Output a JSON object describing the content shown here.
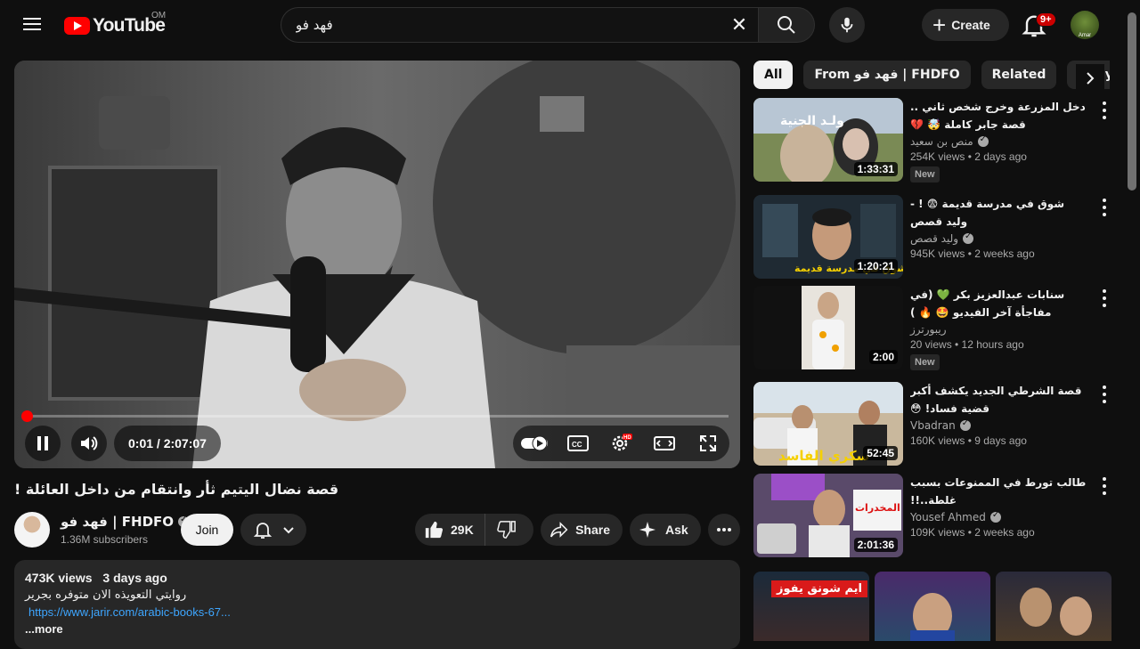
{
  "topbar": {
    "logo_text": "YouTube",
    "country_code": "OM",
    "search_value": "فهد فو",
    "create_label": "Create",
    "notifications_badge": "9+"
  },
  "player": {
    "time_display": "0:01 / 2:07:07",
    "progress_fraction": 0.001
  },
  "video": {
    "title": "قصة نضال اليتيم ثأر وانتقام من داخل العائلة !",
    "channel_name": "فهد فو | FHDFO",
    "subscribers": "1.36M subscribers",
    "join_label": "Join",
    "likes": "29K",
    "share_label": "Share",
    "ask_label": "Ask"
  },
  "description": {
    "views": "473K views",
    "age": "3 days ago",
    "line1": "روايتي التعويذه الان متوفره بجرير",
    "link": "https://www.jarir.com/arabic-books-67...",
    "more": "...more"
  },
  "chips": [
    {
      "label": "All"
    },
    {
      "label": "From فهد فو | FHDFO"
    },
    {
      "label": "Related"
    },
    {
      "label": "For you"
    }
  ],
  "recommendations": [
    {
      "title": "دخل المزرعة وخرج شخص ثاني .. قصة جابر كاملة 🤯 💔",
      "channel": "منص بن سعيد",
      "verified": true,
      "stats": "254K views • 2 days ago",
      "duration": "1:33:31",
      "badge": "New",
      "thumb_text": "ولـد الجنية"
    },
    {
      "title": "شوق في مدرسة قديمة 😨 ! - وليد قصص",
      "channel": "وليد قصص",
      "verified": true,
      "stats": "945K views • 2 weeks ago",
      "duration": "1:20:21",
      "badge": "",
      "thumb_text": "شوق في مدرسة قديمة !"
    },
    {
      "title": "سنابات عبدالعزيز بكر 💚 (في مفاجأة آخر الفيديو 🤩 🔥 )",
      "channel": "ريبورترز",
      "verified": false,
      "stats": "20 views • 12 hours ago",
      "duration": "2:00",
      "badge": "New",
      "thumb_text": ""
    },
    {
      "title": "قصة الشرطي الجديد يكشف أكبر قضية فساد! 😳",
      "channel": "Vbadran",
      "verified": true,
      "stats": "160K views • 9 days ago",
      "duration": "52:45",
      "badge": "",
      "thumb_text": "سكري الفاسد"
    },
    {
      "title": "طالب تورط في الممنوعات بسبب غلطة..!!",
      "channel": "Yousef Ahmed",
      "verified": true,
      "stats": "109K views • 2 weeks ago",
      "duration": "2:01:36",
      "badge": "",
      "thumb_text": "فخ المخدرات"
    }
  ],
  "shorts": [
    {
      "label": "ايم شونق يفوز"
    },
    {
      "label": ""
    },
    {
      "label": ""
    }
  ]
}
